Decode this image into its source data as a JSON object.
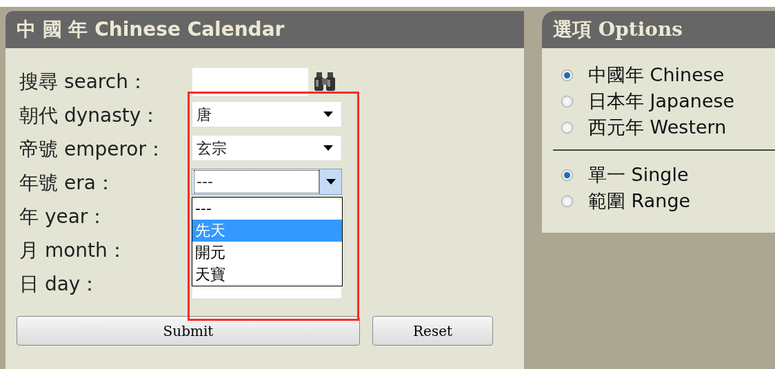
{
  "calendar_panel": {
    "title": "中 國 年 Chinese Calendar",
    "fields": [
      {
        "kind": "text",
        "label": "搜尋 search：",
        "search_button": true
      },
      {
        "kind": "select",
        "label": "朝代 dynasty：",
        "value": "唐"
      },
      {
        "kind": "select",
        "label": "帝號 emperor：",
        "value": "玄宗"
      },
      {
        "kind": "select",
        "label": "年號 era：",
        "value": "---",
        "focused": true,
        "open": true,
        "options": [
          {
            "label": "---",
            "highlighted": false
          },
          {
            "label": "先天",
            "highlighted": true
          },
          {
            "label": "開元",
            "highlighted": false
          },
          {
            "label": "天寶",
            "highlighted": false
          }
        ]
      },
      {
        "kind": "text",
        "label": "年 year："
      },
      {
        "kind": "text",
        "label": "月 month："
      },
      {
        "kind": "text",
        "label": "日 day："
      }
    ],
    "buttons": [
      {
        "label": "Submit",
        "kind": "wide"
      },
      {
        "label": "Reset",
        "kind": "narrow"
      }
    ]
  },
  "options_panel": {
    "title": "選項 Options",
    "groups": [
      [
        {
          "label": "中國年 Chinese",
          "selected": true
        },
        {
          "label": "日本年 Japanese",
          "selected": false
        },
        {
          "label": "西元年 Western",
          "selected": false
        }
      ],
      [
        {
          "label": "單一 Single",
          "selected": true
        },
        {
          "label": "範圍 Range",
          "selected": false
        }
      ]
    ]
  },
  "highlight": true
}
